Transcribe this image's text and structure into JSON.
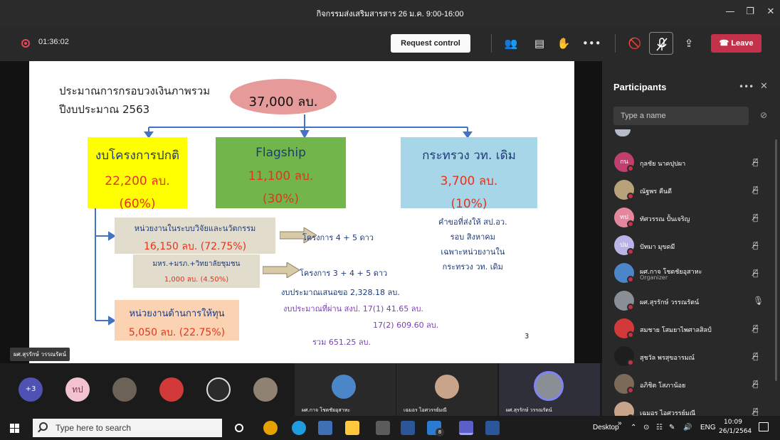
{
  "window": {
    "title": "กิจกรรมส่งเสริมสารสาร 26 ม.ค. 9:00-16:00",
    "controls": [
      "minimize",
      "maximize",
      "close"
    ]
  },
  "toolbar": {
    "recording_time": "01:36:02",
    "request_control": "Request control",
    "leave": "Leave",
    "accent": "#c4314b"
  },
  "slide": {
    "heading_line1": "ประมาณการกรอบวงเงินภาพรวม",
    "heading_line2": "ปีงบประมาณ 2563",
    "total": "37,000 ลบ.",
    "regular": {
      "title": "งบโครงการปกติ",
      "amount": "22,200 ลบ.",
      "pct": "(60%)"
    },
    "flagship": {
      "title": "Flagship",
      "amount": "11,100 ลบ.",
      "pct": "(30%)"
    },
    "ministry": {
      "title": "กระทรวง วท. เดิม",
      "amount": "3,700 ลบ.",
      "pct": "(10%)"
    },
    "research_units": {
      "title": "หน่วยงานในระบบวิจัยและนวัตกรรม",
      "amount": "16,150 ลบ. (72.75%)"
    },
    "universities": {
      "title": "มหร.+มรภ.+วิทยาลัยชุมชน",
      "amount": "1,000 ลบ. (4.50%)"
    },
    "funding_units": {
      "title": "หน่วยงานด้านการให้ทุน",
      "amount": "5,050 ลบ. (22.75%)"
    },
    "project_45": "โครงการ 4 + 5 ดาว",
    "project_345": "โครงการ 3 + 4 + 5 ดาว",
    "ministry_note": [
      "คำขอที่ส่งให้ สป.อว.",
      "รอบ สิงหาคม",
      "เฉพาะหน่วยงานใน",
      "กระทรวง วท. เดิม"
    ],
    "budget_request": "งบประมาณเสนอขอ 2,328.18 ลบ.",
    "budget_passed_1": "งบประมาณที่ผ่าน สงป. 17(1) 41.65 ลบ.",
    "budget_passed_2": "17(2) 609.60 ลบ.",
    "budget_total": "รวม   651.25 ลบ.",
    "page_number": "3"
  },
  "stage": {
    "speaker_name": "ผศ.สุรรักษ์ วรรณรัตน์"
  },
  "strip": {
    "overflow": "+3",
    "initials": "ทป",
    "tiles": [
      "ผศ.กาจ โชตชัยอุสาหะ",
      "เฉมอร ไอศวรรย์มณี",
      "ผศ.สุรรักษ์ วรรณรัตน์"
    ]
  },
  "panel": {
    "title": "Participants",
    "search_placeholder": "Type a name",
    "participants": [
      {
        "initials": "กน",
        "name": "กุลชัย นาคปุปผา",
        "role": "",
        "mic": "muted",
        "color": "#c13f6c"
      },
      {
        "initials": "",
        "name": "ณัฐพร คืนดี",
        "role": "",
        "mic": "muted",
        "color": "#b8a27a"
      },
      {
        "initials": "ทป",
        "name": "ทัศวรรณ ปั้นเจริญ",
        "role": "",
        "mic": "muted",
        "color": "#e3879f"
      },
      {
        "initials": "ปม",
        "name": "ปัทมา มุขดมี",
        "role": "",
        "mic": "muted",
        "color": "#b9b3e6"
      },
      {
        "initials": "",
        "name": "ผศ.กาจ โชตชัยอุสาหะ",
        "role": "Organizer",
        "mic": "muted",
        "color": "#4a86c8"
      },
      {
        "initials": "",
        "name": "ผศ.สุรรักษ์ วรรณรัตน์",
        "role": "",
        "mic": "on",
        "color": "#8a8f96"
      },
      {
        "initials": "",
        "name": "สมชาย โสมยาไพศาลสิลป์",
        "role": "",
        "mic": "muted",
        "color": "#d23a3a"
      },
      {
        "initials": "",
        "name": "สุชวัล พรสุขอารมณ์",
        "role": "",
        "mic": "muted",
        "color": "#1e1e1e"
      },
      {
        "initials": "",
        "name": "อภิชิต โสภาน้อย",
        "role": "",
        "mic": "muted",
        "color": "#7b6a5a"
      },
      {
        "initials": "",
        "name": "เฉมอร ไอศวรรย์มณี",
        "role": "",
        "mic": "muted",
        "color": "#c8a48a"
      }
    ]
  },
  "taskbar": {
    "search_placeholder": "Type here to search",
    "desktop": "Desktop",
    "lang": "ENG",
    "time": "10:09",
    "date": "26/1/2564",
    "badge": "8"
  }
}
